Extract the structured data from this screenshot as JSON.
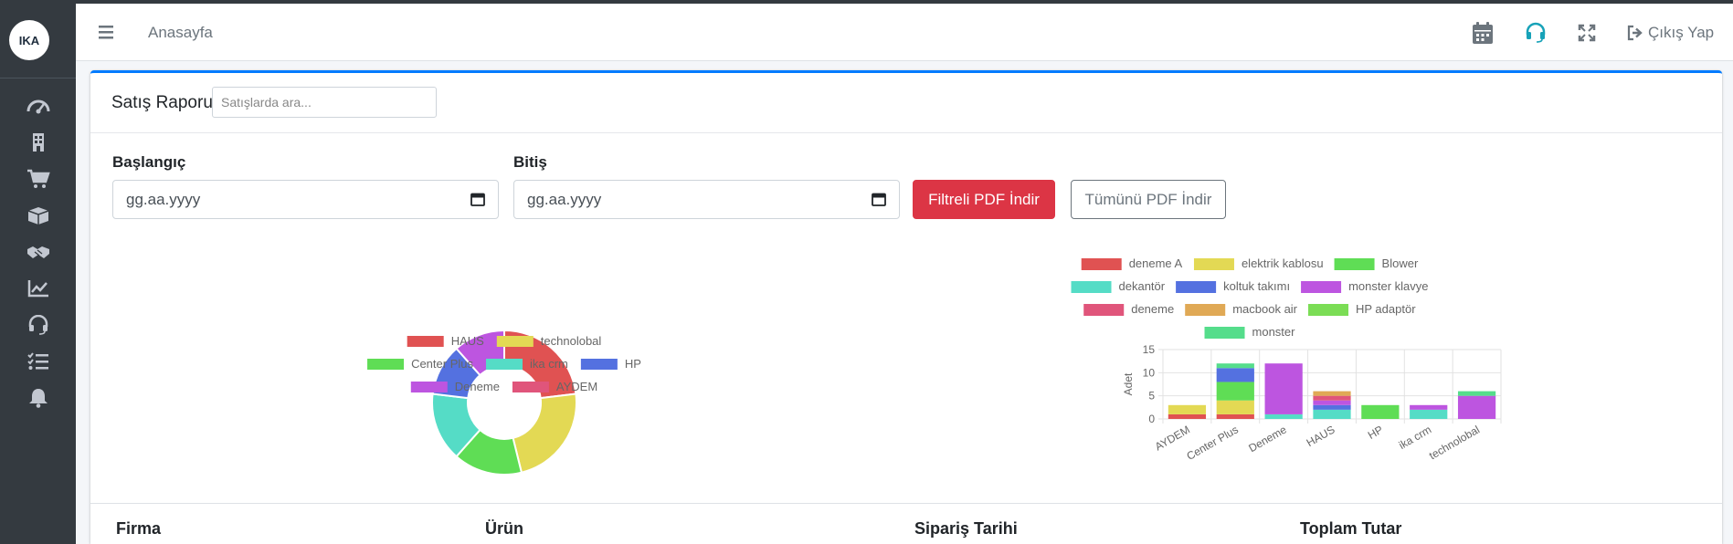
{
  "brand": {
    "logo_text": "IKA"
  },
  "sidebar": {
    "items": [
      {
        "icon": "dashboard-gauge-icon"
      },
      {
        "icon": "building-icon"
      },
      {
        "icon": "shopping-cart-icon"
      },
      {
        "icon": "box-icon"
      },
      {
        "icon": "handshake-icon"
      },
      {
        "icon": "chart-line-icon"
      },
      {
        "icon": "headset-icon"
      },
      {
        "icon": "tasks-icon"
      },
      {
        "icon": "bell-icon"
      }
    ]
  },
  "navbar": {
    "home": "Anasayfa",
    "logout": "Çıkış Yap",
    "icons": [
      "calendar-icon",
      "headset-icon",
      "expand-icon",
      "sign-out-icon"
    ]
  },
  "report": {
    "title": "Satış Raporu",
    "search_placeholder": "Satışlarda ara...",
    "start_label": "Başlangıç",
    "end_label": "Bitiş",
    "start_value": "gg.aa.yyyy",
    "end_value": "gg.aa.yyyy",
    "btn_filtered": "Filtreli PDF İndir",
    "btn_all": "Tümünü PDF İndir"
  },
  "table": {
    "headers": [
      "Firma",
      "Ürün",
      "Sipariş Tarihi",
      "Toplam Tutar"
    ]
  },
  "colors": {
    "accent": "#007bff",
    "danger": "#dc3545",
    "sidebar": "#343a40"
  },
  "chart_data": [
    {
      "type": "pie",
      "variant": "doughnut",
      "categories": [
        "HAUS",
        "technolobal",
        "Center Plus",
        "ika crm",
        "HP",
        "Deneme",
        "AYDEM"
      ],
      "values": [
        6,
        6,
        4,
        4,
        3,
        3,
        0
      ],
      "colors": [
        "#e05252",
        "#e3d954",
        "#5fdd55",
        "#55dcc6",
        "#5471e0",
        "#bd55e0",
        "#e0557b"
      ],
      "legend": "bottom"
    },
    {
      "type": "bar",
      "stacked": true,
      "categories": [
        "AYDEM",
        "Center Plus",
        "Deneme",
        "HAUS",
        "HP",
        "ika crm",
        "technolobal"
      ],
      "ylabel": "Adet",
      "ylim": [
        0,
        15
      ],
      "yticks": [
        0,
        5,
        10,
        15
      ],
      "grid": true,
      "legend": "top",
      "series": [
        {
          "name": "deneme A",
          "color": "#e05252",
          "values": [
            1,
            1,
            0,
            0,
            0,
            0,
            0
          ]
        },
        {
          "name": "elektrik kablosu",
          "color": "#e3d954",
          "values": [
            2,
            3,
            0,
            0,
            0,
            0,
            0
          ]
        },
        {
          "name": "Blower",
          "color": "#5fdd55",
          "values": [
            0,
            4,
            0,
            0,
            3,
            0,
            0
          ]
        },
        {
          "name": "dekantör",
          "color": "#55dcc6",
          "values": [
            0,
            0,
            1,
            2,
            0,
            2,
            0
          ]
        },
        {
          "name": "koltuk takımı",
          "color": "#5471e0",
          "values": [
            0,
            3,
            0,
            1,
            0,
            0,
            0
          ]
        },
        {
          "name": "monster klavye",
          "color": "#bd55e0",
          "values": [
            0,
            0,
            11,
            1,
            0,
            1,
            5
          ]
        },
        {
          "name": "deneme",
          "color": "#e0557b",
          "values": [
            0,
            0,
            0,
            1,
            0,
            0,
            0
          ]
        },
        {
          "name": "macbook air",
          "color": "#e0a955",
          "values": [
            0,
            0,
            0,
            1,
            0,
            0,
            0
          ]
        },
        {
          "name": "HP adaptör",
          "color": "#7bdd55",
          "values": [
            0,
            0,
            0,
            0,
            0,
            0,
            0
          ]
        },
        {
          "name": "monster",
          "color": "#55dd8b",
          "values": [
            0,
            1,
            0,
            0,
            0,
            0,
            1
          ]
        }
      ]
    }
  ]
}
